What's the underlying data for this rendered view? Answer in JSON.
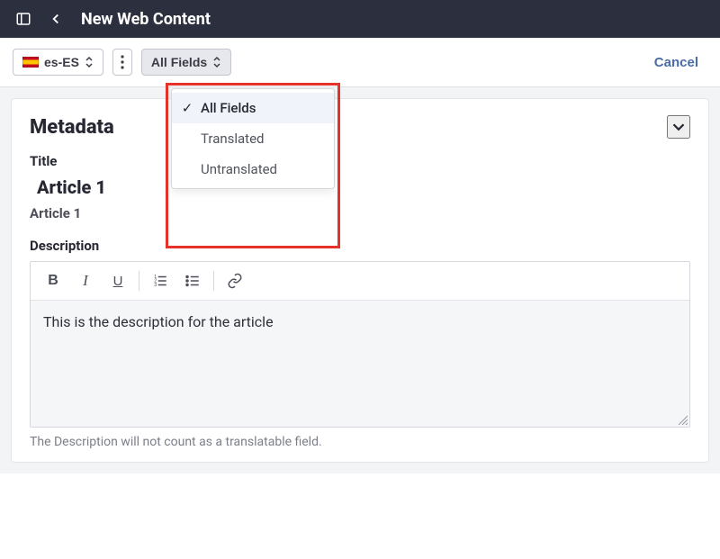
{
  "header": {
    "title": "New Web Content"
  },
  "toolbar": {
    "language": "es-ES",
    "filter_label": "All Fields",
    "cancel_label": "Cancel",
    "filter_options": [
      {
        "label": "All Fields",
        "selected": true
      },
      {
        "label": "Translated",
        "selected": false
      },
      {
        "label": "Untranslated",
        "selected": false
      }
    ]
  },
  "panel": {
    "heading": "Metadata",
    "fields": {
      "title_label": "Title",
      "title_value": "Article 1",
      "title_translated_value": "Article 1",
      "description_label": "Description",
      "description_value": "This is the description for the article",
      "description_hint": "The Description will not count as a translatable field."
    }
  }
}
